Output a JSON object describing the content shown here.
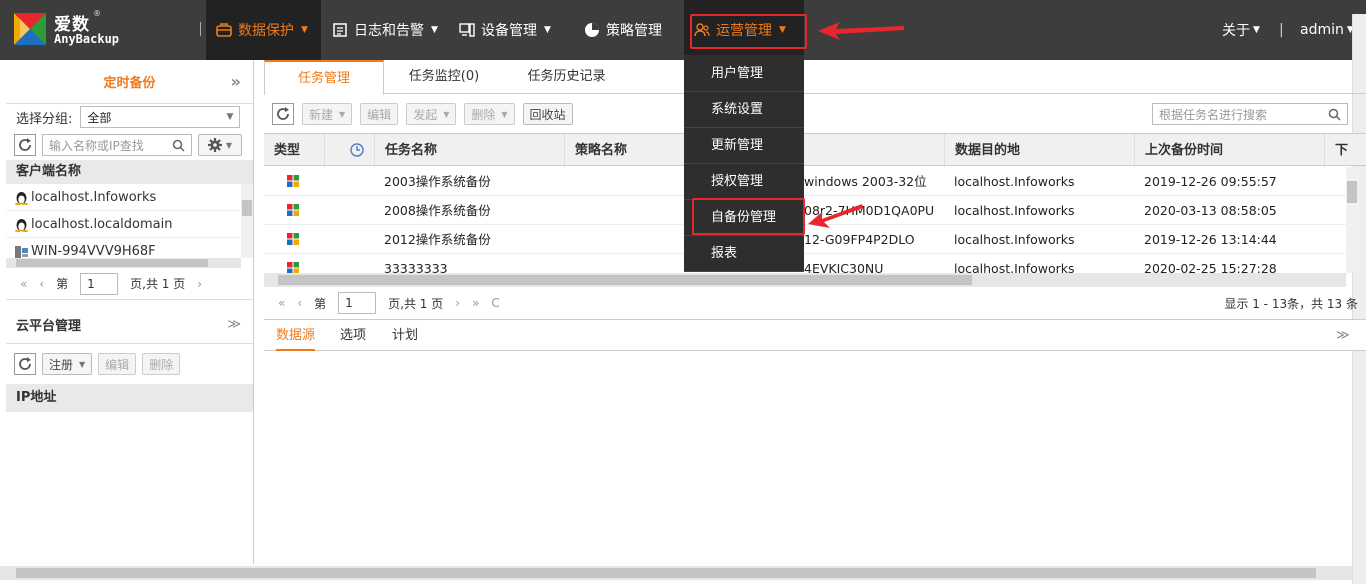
{
  "app": {
    "logo_cn": "爱数",
    "logo_reg": "®",
    "logo_en": "AnyBackup"
  },
  "nav": {
    "items": [
      {
        "label": "数据保护",
        "icon": "briefcase-icon"
      },
      {
        "label": "日志和告警",
        "icon": "log-icon"
      },
      {
        "label": "设备管理",
        "icon": "device-icon"
      },
      {
        "label": "策略管理",
        "icon": "pie-chart-icon"
      },
      {
        "label": "运营管理",
        "icon": "users-icon"
      }
    ],
    "about": "关于",
    "user": "admin",
    "sep": "|"
  },
  "dropdown": {
    "items": [
      "用户管理",
      "系统设置",
      "更新管理",
      "授权管理",
      "自备份管理",
      "报表"
    ]
  },
  "left": {
    "title": "定时备份",
    "collapse": "»",
    "group_label": "选择分组:",
    "group_value": "全部",
    "search_placeholder": "输入名称或IP查找",
    "client_header": "客户端名称",
    "clients": [
      "localhost.Infoworks",
      "localhost.localdomain",
      "WIN-994VVV9H68F"
    ],
    "pager": {
      "first": "«",
      "prev": "‹",
      "page_prefix": "第",
      "page": "1",
      "page_suffix": "页,共 1 页",
      "next": "›"
    },
    "cloud_title": "云平台管理",
    "cloud_collapse": "≫",
    "cloud_buttons": {
      "register": "注册",
      "edit": "编辑",
      "delete": "删除"
    },
    "ip_header": "IP地址"
  },
  "main": {
    "tabs": [
      "任务管理",
      "任务监控(0)",
      "任务历史记录"
    ],
    "toolbar": {
      "new": "新建",
      "edit": "编辑",
      "launch": "发起",
      "delete": "删除",
      "recycle": "回收站"
    },
    "search_placeholder": "根据任务名进行搜索",
    "columns": {
      "type": "类型",
      "name": "任务名称",
      "policy": "策略名称",
      "dest": "数据目的地",
      "last": "上次备份时间",
      "next": "下"
    },
    "rows": [
      {
        "name": "2003操作系统备份",
        "source": "windows 2003-32位",
        "dest": "localhost.Infoworks",
        "last": "2019-12-26 09:55:57"
      },
      {
        "name": "2008操作系统备份",
        "source": "08r2-7HM0D1QA0PU",
        "dest": "localhost.Infoworks",
        "last": "2020-03-13 08:58:05"
      },
      {
        "name": "2012操作系统备份",
        "source": "12-G09FP4P2DLO",
        "dest": "localhost.Infoworks",
        "last": "2019-12-26 13:14:44"
      },
      {
        "name": "33333333",
        "source": "4EVKIC30NU",
        "dest": "localhost.Infoworks",
        "last": "2020-02-25 15:27:28"
      }
    ],
    "pager": {
      "first": "«",
      "prev": "‹",
      "page_prefix": "第",
      "page": "1",
      "page_suffix": "页,共 1 页",
      "next": "›",
      "last": "»",
      "refresh": "C",
      "summary": "显示 1 - 13条，共 13 条"
    },
    "subtabs": [
      "数据源",
      "选项",
      "计划"
    ]
  },
  "colors": {
    "accent": "#f07a1a",
    "topbar": "#3d3d3d",
    "highlight": "#e8262b"
  }
}
